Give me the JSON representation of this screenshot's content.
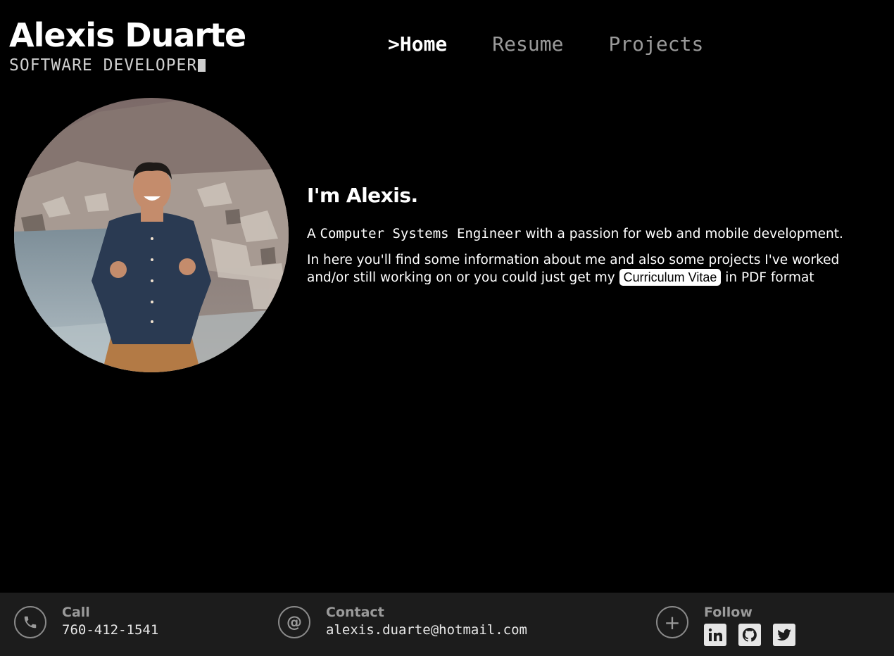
{
  "brand": {
    "name": "Alexis Duarte",
    "role": "SOFTWARE DEVELOPER"
  },
  "nav": {
    "home": ">Home",
    "resume": "Resume",
    "projects": "Projects"
  },
  "intro": {
    "heading": "I'm Alexis.",
    "line1_prefix": "A ",
    "line1_code": "Computer Systems Engineer",
    "line1_suffix": " with a passion for web and mobile development.",
    "line2_prefix": "In here you'll find some information about me and also some projects I've worked and/or still working on or you could just get my ",
    "cv_button": "Curriculum Vitae",
    "line2_suffix": " in PDF format"
  },
  "footer": {
    "call": {
      "label": "Call",
      "value": "760-412-1541",
      "icon": "phone-icon"
    },
    "contact": {
      "label": "Contact",
      "value": "alexis.duarte@hotmail.com",
      "icon": "at-icon"
    },
    "follow": {
      "label": "Follow",
      "icon": "plus-icon",
      "links": [
        "linkedin-icon",
        "github-icon",
        "twitter-icon"
      ]
    }
  }
}
